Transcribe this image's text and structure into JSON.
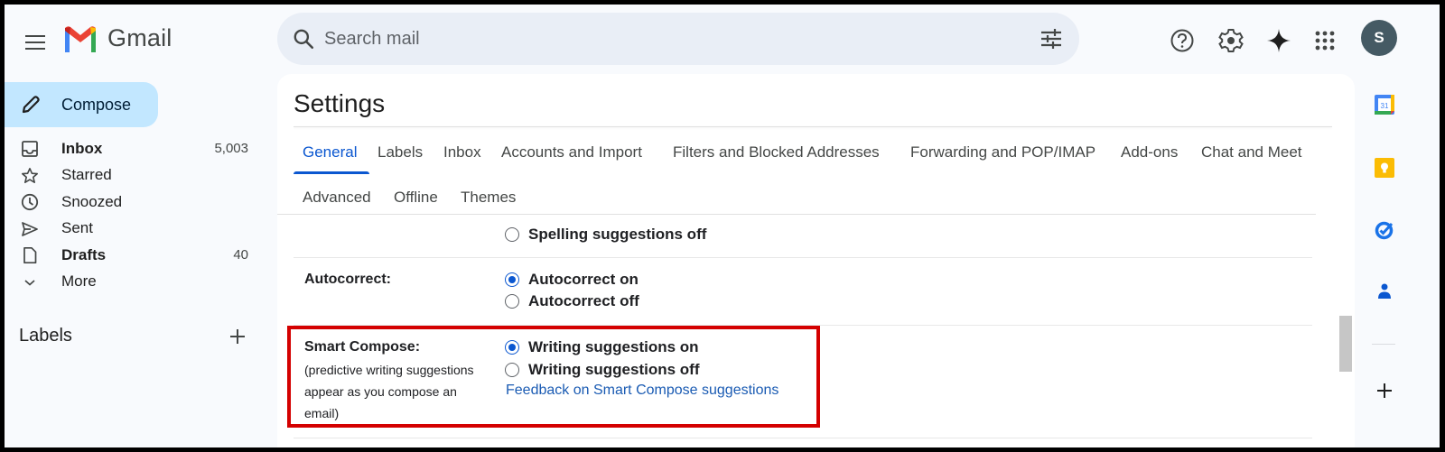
{
  "app": {
    "name": "Gmail",
    "menu_icon": "hamburger-menu-icon",
    "logo_icon": "gmail-logo-icon"
  },
  "header": {
    "search_placeholder": "Search mail",
    "search_value": "",
    "icons": [
      "search-icon",
      "search-options-icon",
      "help-icon",
      "settings-gear-icon",
      "gemini-sparkle-icon",
      "google-apps-icon"
    ],
    "avatar_initial": "S",
    "avatar_color": "#455a64"
  },
  "sidebar": {
    "compose_label": "Compose",
    "items": [
      {
        "label": "Inbox",
        "count": "5,003",
        "bold": true,
        "icon": "inbox-icon"
      },
      {
        "label": "Starred",
        "count": "",
        "bold": false,
        "icon": "star-icon"
      },
      {
        "label": "Snoozed",
        "count": "",
        "bold": false,
        "icon": "clock-icon"
      },
      {
        "label": "Sent",
        "count": "",
        "bold": false,
        "icon": "send-icon"
      },
      {
        "label": "Drafts",
        "count": "40",
        "bold": true,
        "icon": "draft-icon"
      },
      {
        "label": "More",
        "count": "",
        "bold": false,
        "icon": "chevron-down-icon"
      }
    ],
    "labels_heading": "Labels",
    "labels_add": "+"
  },
  "settings": {
    "title": "Settings",
    "tabs_row1": [
      "General",
      "Labels",
      "Inbox",
      "Accounts and Import",
      "Filters and Blocked Addresses",
      "Forwarding and POP/IMAP",
      "Add-ons",
      "Chat and Meet"
    ],
    "tabs_row2": [
      "Advanced",
      "Offline",
      "Themes"
    ],
    "active_tab": "General",
    "spelling": {
      "options": [
        {
          "label": "Spelling suggestions off",
          "checked": false
        }
      ]
    },
    "autocorrect": {
      "label": "Autocorrect:",
      "options": [
        {
          "label": "Autocorrect on",
          "checked": true
        },
        {
          "label": "Autocorrect off",
          "checked": false
        }
      ]
    },
    "smart_compose": {
      "label": "Smart Compose:",
      "description_lines": [
        "(predictive writing suggestions",
        "appear as you compose an",
        "email)"
      ],
      "options": [
        {
          "label": "Writing suggestions on",
          "checked": true
        },
        {
          "label": "Writing suggestions off",
          "checked": false
        }
      ],
      "feedback_link": "Feedback on Smart Compose suggestions",
      "highlighted": true,
      "highlight_color": "#d40000"
    }
  },
  "side_panel": {
    "apps": [
      "google-calendar-icon",
      "google-keep-icon",
      "google-tasks-icon",
      "google-contacts-icon",
      "add-addon-icon"
    ],
    "calendar_day": "31"
  },
  "colors": {
    "accent": "#0b57d0",
    "compose_bg": "#c2e7ff",
    "search_bg": "#e9eef6",
    "page_bg": "#f8fafd",
    "link": "#1a5bb3"
  }
}
